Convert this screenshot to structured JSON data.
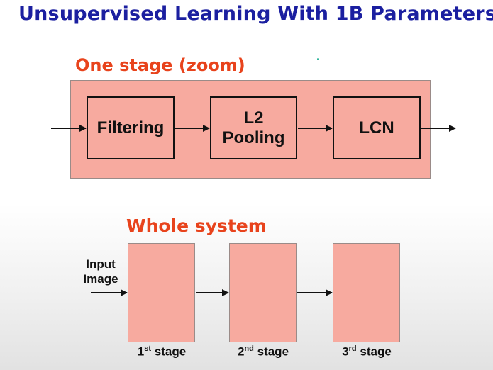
{
  "title": "Unsupervised Learning With 1B Parameters",
  "one_stage": {
    "label": "One stage (zoom)",
    "ops": {
      "filtering": "Filtering",
      "pooling_line1": "L2",
      "pooling_line2": "Pooling",
      "lcn": "LCN"
    }
  },
  "whole_system": {
    "label": "Whole system",
    "input_line1": "Input",
    "input_line2": "Image",
    "stages": [
      {
        "num": "1",
        "suffix": "st",
        "word": "stage"
      },
      {
        "num": "2",
        "suffix": "nd",
        "word": "stage"
      },
      {
        "num": "3",
        "suffix": "rd",
        "word": "stage"
      }
    ]
  },
  "colors": {
    "title": "#1b1fa0",
    "section_label": "#e8431c",
    "box_fill": "#f7aa9f"
  }
}
